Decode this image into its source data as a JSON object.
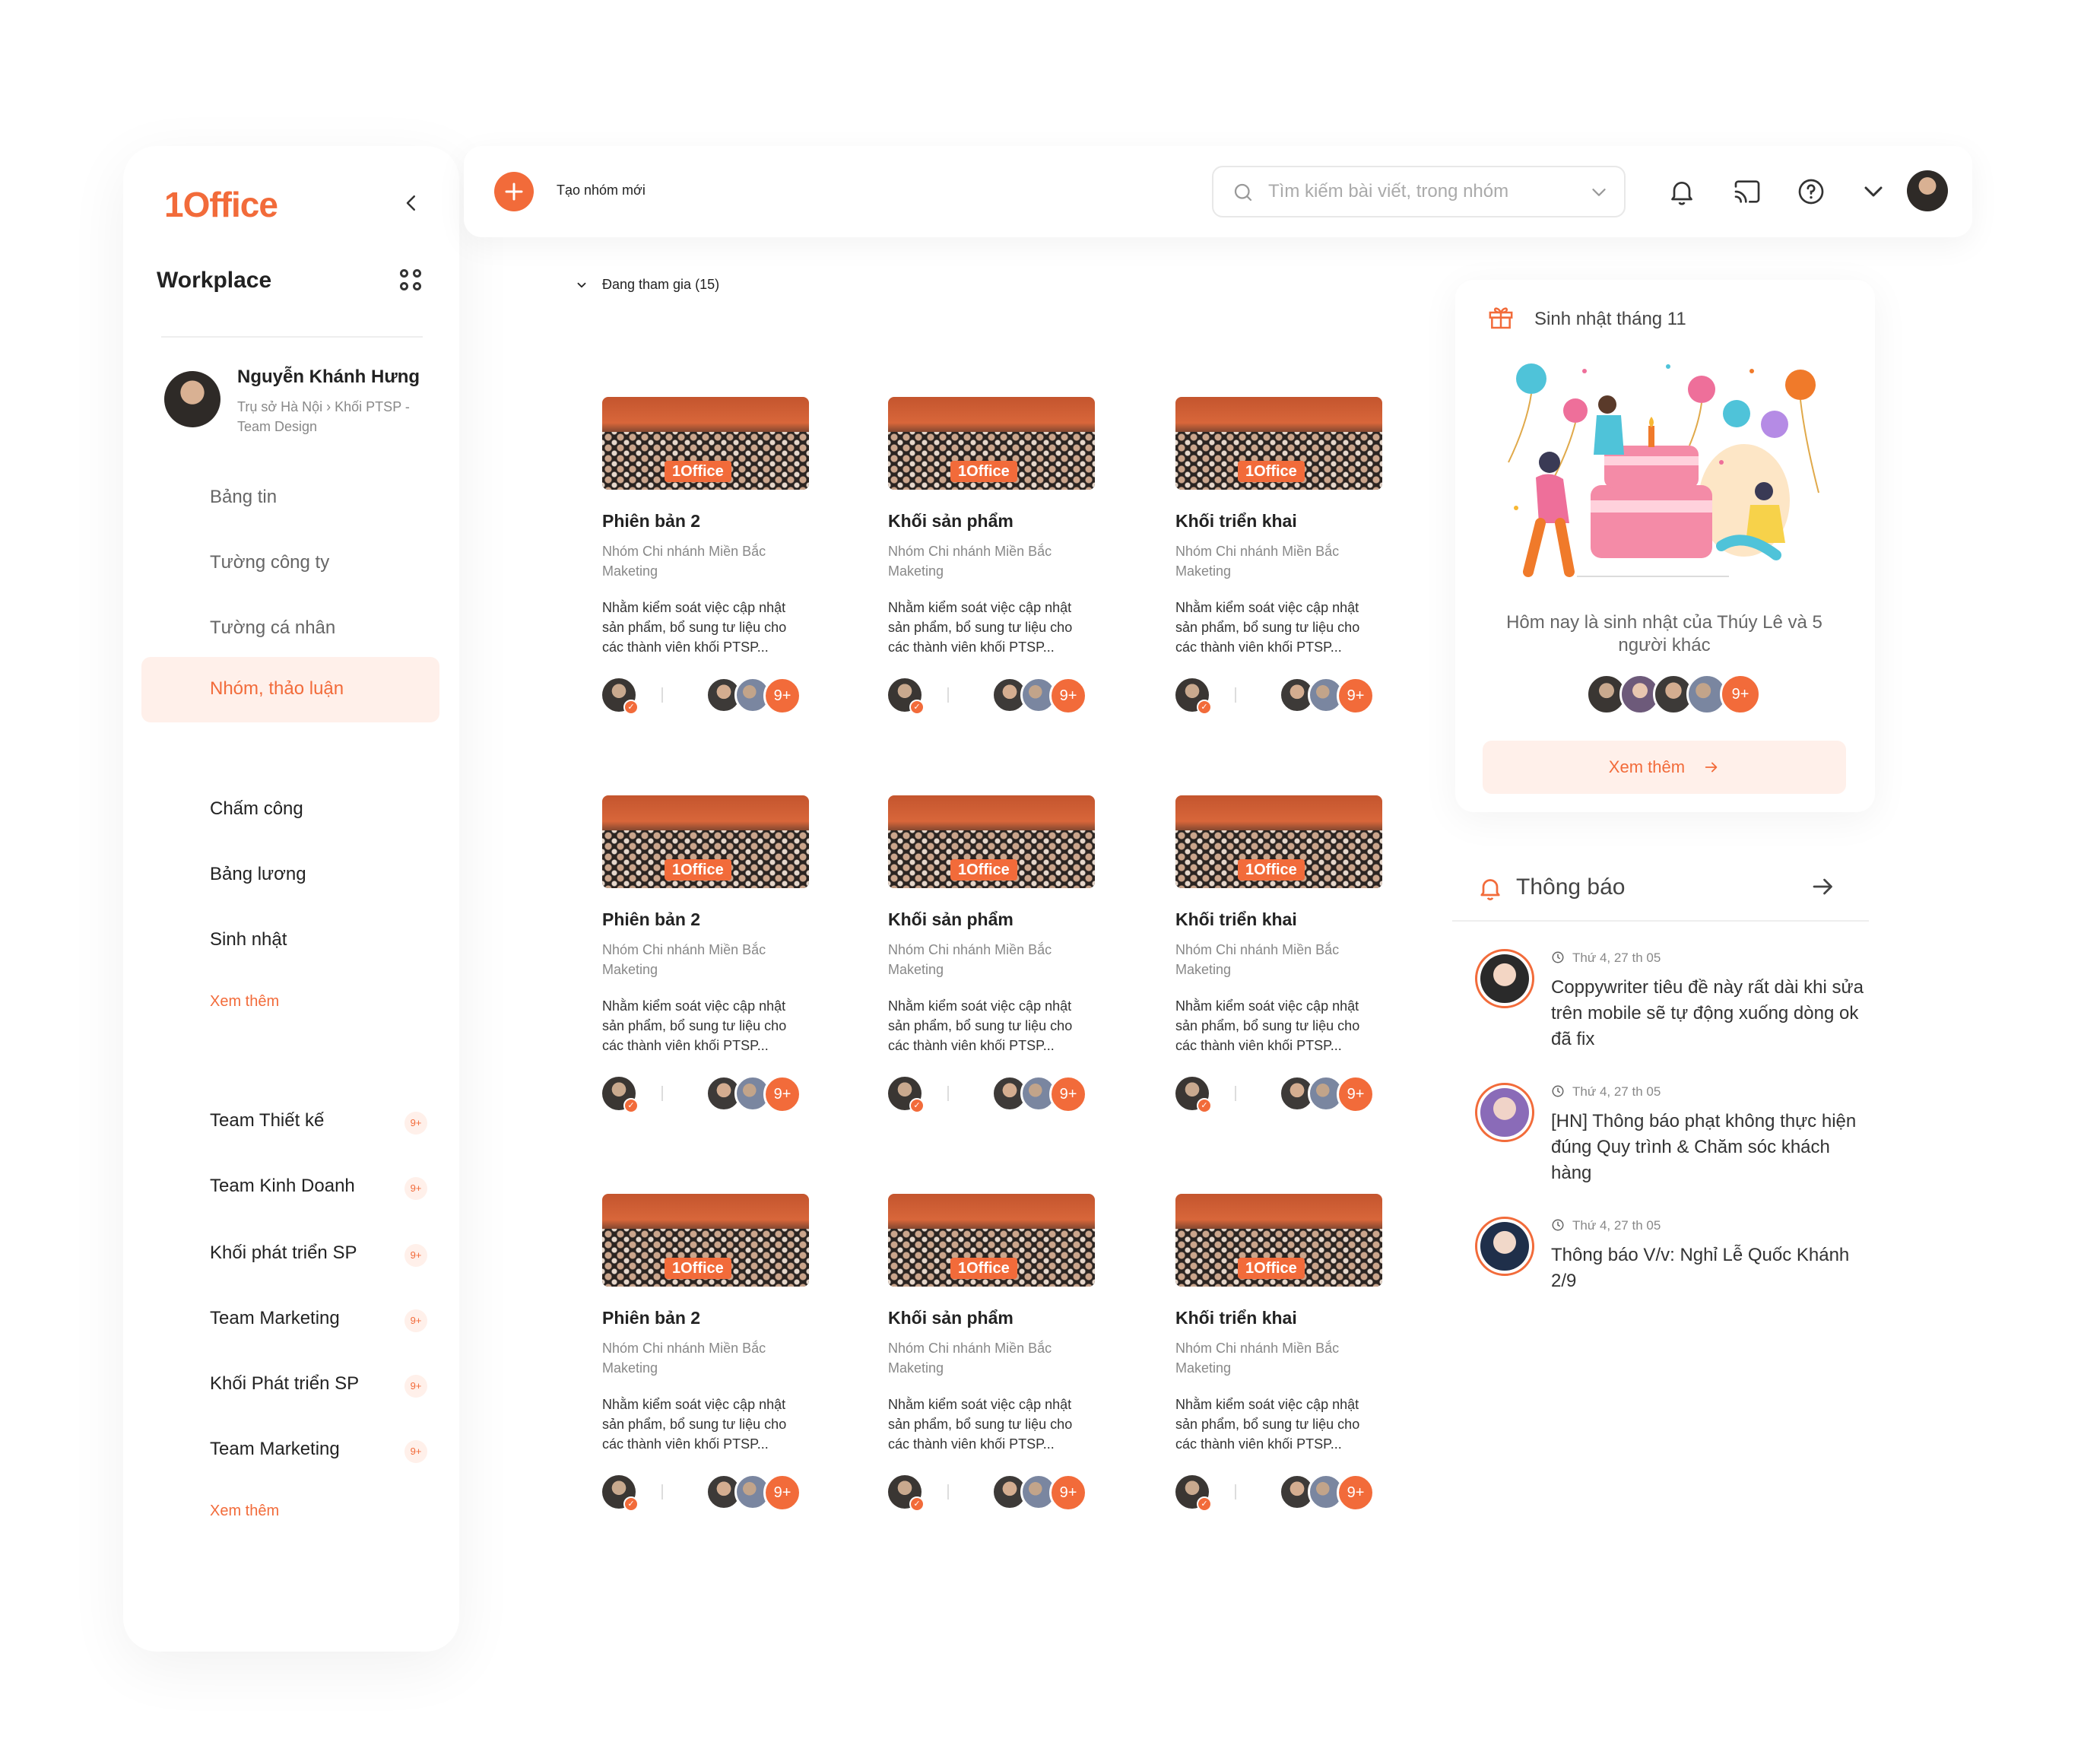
{
  "sidebar": {
    "logo": "1Office",
    "workspace_title": "Workplace",
    "profile": {
      "name": "Nguyễn Khánh Hưng",
      "org": "Trụ sở Hà Nội › Khối PTSP - Team Design"
    },
    "nav": [
      "Bảng tin",
      "Tường công ty",
      "Tường cá nhân"
    ],
    "active_nav": "Nhóm, thảo luận",
    "tools": [
      "Chấm công",
      "Bảng lương",
      "Sinh nhật"
    ],
    "tools_more": "Xem thêm",
    "groups": [
      {
        "label": "Team Thiết kế",
        "badge": "9+"
      },
      {
        "label": "Team Kinh Doanh",
        "badge": "9+"
      },
      {
        "label": "Khối phát triển SP",
        "badge": "9+"
      },
      {
        "label": "Team Marketing",
        "badge": "9+"
      },
      {
        "label": "Khối Phát triển SP",
        "badge": "9+"
      },
      {
        "label": "Team Marketing",
        "badge": "9+"
      }
    ],
    "groups_more": "Xem thêm"
  },
  "topbar": {
    "add_label": "Tạo nhóm mới",
    "search_placeholder": "Tìm kiếm bài viết, trong nhóm"
  },
  "main": {
    "joined_label": "Đang tham gia (15)",
    "cards": [
      {
        "title": "Phiên bản 2",
        "sub": "Nhóm Chi nhánh Miền Bắc Maketing",
        "desc": "Nhằm kiểm soát việc cập nhật sản phẩm, bổ sung tư liệu cho các thành viên khối PTSP...",
        "brand": "1Office",
        "more": "9+"
      },
      {
        "title": "Khối sản phẩm",
        "sub": "Nhóm Chi nhánh Miền Bắc Maketing",
        "desc": "Nhằm kiểm soát việc cập nhật sản phẩm, bổ sung tư liệu cho các thành viên khối PTSP...",
        "brand": "1Office",
        "more": "9+"
      },
      {
        "title": "Khối triển khai",
        "sub": "Nhóm Chi nhánh Miền Bắc Maketing",
        "desc": "Nhằm kiểm soát việc cập nhật sản phẩm, bổ sung tư liệu cho các thành viên khối PTSP...",
        "brand": "1Office",
        "more": "9+"
      },
      {
        "title": "Phiên bản 2",
        "sub": "Nhóm Chi nhánh Miền Bắc Maketing",
        "desc": "Nhằm kiểm soát việc cập nhật sản phẩm, bổ sung tư liệu cho các thành viên khối PTSP...",
        "brand": "1Office",
        "more": "9+"
      },
      {
        "title": "Khối sản phẩm",
        "sub": "Nhóm Chi nhánh Miền Bắc Maketing",
        "desc": "Nhằm kiểm soát việc cập nhật sản phẩm, bổ sung tư liệu cho các thành viên khối PTSP...",
        "brand": "1Office",
        "more": "9+"
      },
      {
        "title": "Khối triển khai",
        "sub": "Nhóm Chi nhánh Miền Bắc Maketing",
        "desc": "Nhằm kiểm soát việc cập nhật sản phẩm, bổ sung tư liệu cho các thành viên khối PTSP...",
        "brand": "1Office",
        "more": "9+"
      },
      {
        "title": "Phiên bản 2",
        "sub": "Nhóm Chi nhánh Miền Bắc Maketing",
        "desc": "Nhằm kiểm soát việc cập nhật sản phẩm, bổ sung tư liệu cho các thành viên khối PTSP...",
        "brand": "1Office",
        "more": "9+"
      },
      {
        "title": "Khối sản phẩm",
        "sub": "Nhóm Chi nhánh Miền Bắc Maketing",
        "desc": "Nhằm kiểm soát việc cập nhật sản phẩm, bổ sung tư liệu cho các thành viên khối PTSP...",
        "brand": "1Office",
        "more": "9+"
      },
      {
        "title": "Khối triển khai",
        "sub": "Nhóm Chi nhánh Miền Bắc Maketing",
        "desc": "Nhằm kiểm soát việc cập nhật sản phẩm, bổ sung tư liệu cho các thành viên khối PTSP...",
        "brand": "1Office",
        "more": "9+"
      }
    ]
  },
  "birthday": {
    "title": "Sinh nhật tháng 11",
    "text": "Hôm nay là sinh nhật của Thúy Lê và 5 người khác",
    "more_count": "9+",
    "more_label": "Xem thêm"
  },
  "notifications": {
    "title": "Thông báo",
    "items": [
      {
        "time": "Thứ 4, 27 th 05",
        "text": "Coppywriter tiêu đề này rất dài khi sửa trên mobile sẽ tự động xuống dòng ok đã fix"
      },
      {
        "time": "Thứ 4, 27 th 05",
        "text": "[HN] Thông báo phạt không thực hiện đúng Quy trình & Chăm sóc khách hàng"
      },
      {
        "time": "Thứ 4, 27 th 05",
        "text": "Thông báo V/v: Nghỉ Lễ Quốc Khánh 2/9"
      }
    ]
  },
  "colors": {
    "accent": "#f26b3a",
    "accent_light": "#fff0ea"
  },
  "icons": [
    "chevron-left-icon",
    "apps-grid-icon",
    "plus-icon",
    "search-icon",
    "chevron-down-icon",
    "bell-icon",
    "cast-icon",
    "help-icon",
    "gift-icon",
    "arrow-right-icon",
    "clock-icon",
    "verified-check-icon"
  ]
}
